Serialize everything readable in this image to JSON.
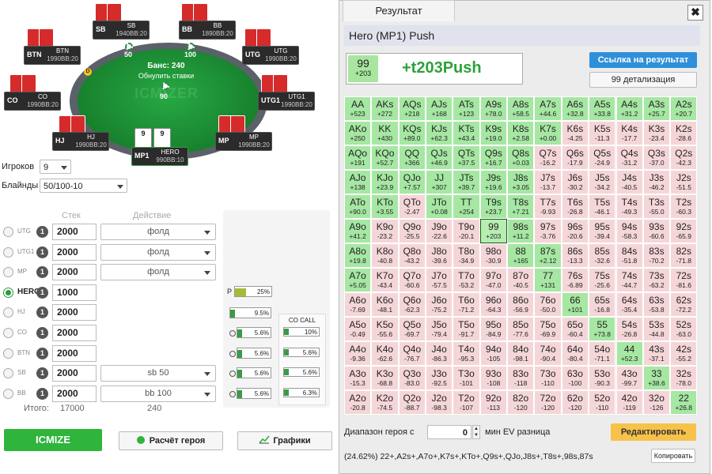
{
  "table": {
    "pot_label": "Банс: 240",
    "refresh_label": "Обнулить ставки",
    "watermark": "ICMIZER",
    "dealer_label": "D",
    "bets": {
      "sb": "50",
      "bb": "100",
      "hero": "90"
    },
    "seats": {
      "sb": {
        "pos": "SB",
        "name": "SB",
        "stack": "1940BB:20"
      },
      "bb": {
        "pos": "BB",
        "name": "BB",
        "stack": "1890BB:20"
      },
      "btn": {
        "pos": "BTN",
        "name": "BTN",
        "stack": "1990BB:20"
      },
      "utg": {
        "pos": "UTG",
        "name": "UTG",
        "stack": "1990BB:20"
      },
      "co": {
        "pos": "CO",
        "name": "CO",
        "stack": "1990BB:20"
      },
      "utg1": {
        "pos": "UTG1",
        "name": "UTG1",
        "stack": "1990BB:20"
      },
      "hj": {
        "pos": "HJ",
        "name": "HJ",
        "stack": "1990BB:20"
      },
      "mp": {
        "pos": "MP",
        "name": "MP",
        "stack": "1990BB:20"
      },
      "mp1": {
        "pos": "MP1",
        "name": "HERO",
        "stack": "990BB:10"
      }
    },
    "hero_cards": [
      "9",
      "9"
    ]
  },
  "controls": {
    "players_label": "Игроков",
    "players_value": "9",
    "blinds_label": "Блайнды",
    "blinds_value": "50/100-10",
    "stack_header": "Стек",
    "action_header": "Действие",
    "totals_label": "Итого:",
    "total_stack": "17000",
    "total_pot": "240"
  },
  "players": [
    {
      "pos": "UTG",
      "badge": "1",
      "stack": "2000",
      "action": "фолд"
    },
    {
      "pos": "UTG1",
      "badge": "1",
      "stack": "2000",
      "action": "фолд"
    },
    {
      "pos": "MP",
      "badge": "1",
      "stack": "2000",
      "action": "фолд"
    },
    {
      "pos": "HERO",
      "badge": "1",
      "stack": "1000",
      "action": ""
    },
    {
      "pos": "HJ",
      "badge": "1",
      "stack": "2000",
      "action": ""
    },
    {
      "pos": "CO",
      "badge": "1",
      "stack": "2000",
      "action": ""
    },
    {
      "pos": "BTN",
      "badge": "1",
      "stack": "2000",
      "action": ""
    },
    {
      "pos": "SB",
      "badge": "1",
      "stack": "2000",
      "action": "sb 50"
    },
    {
      "pos": "BB",
      "badge": "1",
      "stack": "2000",
      "action": "bb 100"
    }
  ],
  "mini": {
    "p_label": "P",
    "p_pct": "25%",
    "hj_pct": "9.5%",
    "o_pcts": [
      "5.6%",
      "5.6%",
      "5.6%",
      "5.6%"
    ],
    "co_call_title": "CO CALL",
    "co_call": [
      "10%",
      "5.6%",
      "5.6%",
      "6.3%"
    ]
  },
  "buttons": {
    "icmize": "ICMIZE",
    "hero_calc": "Расчёт героя",
    "charts": "Графики"
  },
  "dialog": {
    "tab": "Результат",
    "close": "✖",
    "title": "Hero (MP1) Push",
    "result_hand": "99",
    "result_value": "+203",
    "result_main": "+t203Push",
    "link_button": "Ссылка на результат",
    "detail_button": "99 детализация",
    "range_label": "Диапазон героя с",
    "range_value": "0",
    "range_suffix": "мин EV разница",
    "edit_button": "Редактировать",
    "range_text": "(24.62%) 22+,A2s+,A7o+,K7s+,KTo+,Q9s+,QJo,J8s+,T8s+,98s,87s",
    "copy_button": "Копировать"
  },
  "colors": {
    "push": "#a6e7a3",
    "fold": "#f5d6d8",
    "accent": "#2fb43c",
    "link": "#2f8fd9",
    "edit": "#f7c24a"
  },
  "matrix": [
    [
      [
        "AA",
        "+523",
        1
      ],
      [
        "AKs",
        "+272",
        1
      ],
      [
        "AQs",
        "+218",
        1
      ],
      [
        "AJs",
        "+168",
        1
      ],
      [
        "ATs",
        "+123",
        1
      ],
      [
        "A9s",
        "+78.0",
        1
      ],
      [
        "A8s",
        "+58.5",
        1
      ],
      [
        "A7s",
        "+44.6",
        1
      ],
      [
        "A6s",
        "+32.8",
        1
      ],
      [
        "A5s",
        "+33.8",
        1
      ],
      [
        "A4s",
        "+31.2",
        1
      ],
      [
        "A3s",
        "+25.7",
        1
      ],
      [
        "A2s",
        "+20.7",
        1
      ]
    ],
    [
      [
        "AKo",
        "+250",
        1
      ],
      [
        "KK",
        "+430",
        1
      ],
      [
        "KQs",
        "+89.0",
        1
      ],
      [
        "KJs",
        "+62.3",
        1
      ],
      [
        "KTs",
        "+43.4",
        1
      ],
      [
        "K9s",
        "+19.0",
        1
      ],
      [
        "K8s",
        "+2.58",
        1
      ],
      [
        "K7s",
        "+0.00",
        1
      ],
      [
        "K6s",
        "-4.25",
        0
      ],
      [
        "K5s",
        "-11.3",
        0
      ],
      [
        "K4s",
        "-17.7",
        0
      ],
      [
        "K3s",
        "-23.4",
        0
      ],
      [
        "K2s",
        "-28.6",
        0
      ]
    ],
    [
      [
        "AQo",
        "+191",
        1
      ],
      [
        "KQo",
        "+52.7",
        1
      ],
      [
        "QQ",
        "+366",
        1
      ],
      [
        "QJs",
        "+46.9",
        1
      ],
      [
        "QTs",
        "+37.5",
        1
      ],
      [
        "Q9s",
        "+16.7",
        1
      ],
      [
        "Q8s",
        "+0.03",
        1
      ],
      [
        "Q7s",
        "-16.2",
        0
      ],
      [
        "Q6s",
        "-17.9",
        0
      ],
      [
        "Q5s",
        "-24.9",
        0
      ],
      [
        "Q4s",
        "-31.2",
        0
      ],
      [
        "Q3s",
        "-37.0",
        0
      ],
      [
        "Q2s",
        "-42.3",
        0
      ]
    ],
    [
      [
        "AJo",
        "+138",
        1
      ],
      [
        "KJo",
        "+23.9",
        1
      ],
      [
        "QJo",
        "+7.57",
        1
      ],
      [
        "JJ",
        "+307",
        1
      ],
      [
        "JTs",
        "+39.7",
        1
      ],
      [
        "J9s",
        "+19.6",
        1
      ],
      [
        "J8s",
        "+3.05",
        1
      ],
      [
        "J7s",
        "-13.7",
        0
      ],
      [
        "J6s",
        "-30.2",
        0
      ],
      [
        "J5s",
        "-34.2",
        0
      ],
      [
        "J4s",
        "-40.5",
        0
      ],
      [
        "J3s",
        "-46.2",
        0
      ],
      [
        "J2s",
        "-51.5",
        0
      ]
    ],
    [
      [
        "ATo",
        "+90.0",
        1
      ],
      [
        "KTo",
        "+3.55",
        1
      ],
      [
        "QTo",
        "-2.47",
        0
      ],
      [
        "JTo",
        "+0.08",
        1
      ],
      [
        "TT",
        "+254",
        1
      ],
      [
        "T9s",
        "+23.7",
        1
      ],
      [
        "T8s",
        "+7.21",
        1
      ],
      [
        "T7s",
        "-9.93",
        0
      ],
      [
        "T6s",
        "-26.8",
        0
      ],
      [
        "T5s",
        "-46.1",
        0
      ],
      [
        "T4s",
        "-49.3",
        0
      ],
      [
        "T3s",
        "-55.0",
        0
      ],
      [
        "T2s",
        "-60.3",
        0
      ]
    ],
    [
      [
        "A9o",
        "+41.2",
        1
      ],
      [
        "K9o",
        "-23.2",
        0
      ],
      [
        "Q9o",
        "-25.5",
        0
      ],
      [
        "J9o",
        "-22.6",
        0
      ],
      [
        "T9o",
        "-20.1",
        0
      ],
      [
        "99",
        "+203",
        2
      ],
      [
        "98s",
        "+11.2",
        1
      ],
      [
        "97s",
        "-3.76",
        0
      ],
      [
        "96s",
        "-20.6",
        0
      ],
      [
        "95s",
        "-39.4",
        0
      ],
      [
        "94s",
        "-58.3",
        0
      ],
      [
        "93s",
        "-60.6",
        0
      ],
      [
        "92s",
        "-65.9",
        0
      ]
    ],
    [
      [
        "A8o",
        "+19.8",
        1
      ],
      [
        "K8o",
        "-40.8",
        0
      ],
      [
        "Q8o",
        "-43.2",
        0
      ],
      [
        "J8o",
        "-39.6",
        0
      ],
      [
        "T8o",
        "-34.9",
        0
      ],
      [
        "98o",
        "-30.9",
        0
      ],
      [
        "88",
        "+165",
        1
      ],
      [
        "87s",
        "+2.12",
        1
      ],
      [
        "86s",
        "-13.3",
        0
      ],
      [
        "85s",
        "-32.6",
        0
      ],
      [
        "84s",
        "-51.8",
        0
      ],
      [
        "83s",
        "-70.2",
        0
      ],
      [
        "82s",
        "-71.8",
        0
      ]
    ],
    [
      [
        "A7o",
        "+5.05",
        1
      ],
      [
        "K7o",
        "-43.4",
        0
      ],
      [
        "Q7o",
        "-60.6",
        0
      ],
      [
        "J7o",
        "-57.5",
        0
      ],
      [
        "T7o",
        "-53.2",
        0
      ],
      [
        "97o",
        "-47.0",
        0
      ],
      [
        "87o",
        "-40.5",
        0
      ],
      [
        "77",
        "+131",
        1
      ],
      [
        "76s",
        "-6.89",
        0
      ],
      [
        "75s",
        "-25.6",
        0
      ],
      [
        "74s",
        "-44.7",
        0
      ],
      [
        "73s",
        "-63.2",
        0
      ],
      [
        "72s",
        "-81.6",
        0
      ]
    ],
    [
      [
        "A6o",
        "-7.69",
        0
      ],
      [
        "K6o",
        "-48.1",
        0
      ],
      [
        "Q6o",
        "-62.3",
        0
      ],
      [
        "J6o",
        "-75.2",
        0
      ],
      [
        "T6o",
        "-71.2",
        0
      ],
      [
        "96o",
        "-64.3",
        0
      ],
      [
        "86o",
        "-56.9",
        0
      ],
      [
        "76o",
        "-50.0",
        0
      ],
      [
        "66",
        "+101",
        1
      ],
      [
        "65s",
        "-16.8",
        0
      ],
      [
        "64s",
        "-35.4",
        0
      ],
      [
        "63s",
        "-53.8",
        0
      ],
      [
        "62s",
        "-72.2",
        0
      ]
    ],
    [
      [
        "A5o",
        "-0.49",
        0
      ],
      [
        "K5o",
        "-55.6",
        0
      ],
      [
        "Q5o",
        "-69.7",
        0
      ],
      [
        "J5o",
        "-79.4",
        0
      ],
      [
        "T5o",
        "-91.7",
        0
      ],
      [
        "95o",
        "-84.9",
        0
      ],
      [
        "85o",
        "-77.6",
        0
      ],
      [
        "75o",
        "-69.9",
        0
      ],
      [
        "65o",
        "-60.4",
        0
      ],
      [
        "55",
        "+73.8",
        1
      ],
      [
        "54s",
        "-26.8",
        0
      ],
      [
        "53s",
        "-44.8",
        0
      ],
      [
        "52s",
        "-63.0",
        0
      ]
    ],
    [
      [
        "A4o",
        "-9.36",
        0
      ],
      [
        "K4o",
        "-62.6",
        0
      ],
      [
        "Q4o",
        "-76.7",
        0
      ],
      [
        "J4o",
        "-86.3",
        0
      ],
      [
        "T4o",
        "-95.3",
        0
      ],
      [
        "94o",
        "-105",
        0
      ],
      [
        "84o",
        "-98.1",
        0
      ],
      [
        "74o",
        "-90.4",
        0
      ],
      [
        "64o",
        "-80.4",
        0
      ],
      [
        "54o",
        "-71.1",
        0
      ],
      [
        "44",
        "+52.3",
        1
      ],
      [
        "43s",
        "-37.1",
        0
      ],
      [
        "42s",
        "-55.2",
        0
      ]
    ],
    [
      [
        "A3o",
        "-15.3",
        0
      ],
      [
        "K3o",
        "-68.8",
        0
      ],
      [
        "Q3o",
        "-83.0",
        0
      ],
      [
        "J3o",
        "-92.5",
        0
      ],
      [
        "T3o",
        "-101",
        0
      ],
      [
        "93o",
        "-108",
        0
      ],
      [
        "83o",
        "-118",
        0
      ],
      [
        "73o",
        "-110",
        0
      ],
      [
        "63o",
        "-100",
        0
      ],
      [
        "53o",
        "-90.3",
        0
      ],
      [
        "43o",
        "-99.7",
        0
      ],
      [
        "33",
        "+38.6",
        1
      ],
      [
        "32s",
        "-78.0",
        0
      ]
    ],
    [
      [
        "A2o",
        "-20.8",
        0
      ],
      [
        "K2o",
        "-74.5",
        0
      ],
      [
        "Q2o",
        "-88.7",
        0
      ],
      [
        "J2o",
        "-98.3",
        0
      ],
      [
        "T2o",
        "-107",
        0
      ],
      [
        "92o",
        "-113",
        0
      ],
      [
        "82o",
        "-120",
        0
      ],
      [
        "72o",
        "-120",
        0
      ],
      [
        "62o",
        "-120",
        0
      ],
      [
        "52o",
        "-110",
        0
      ],
      [
        "42o",
        "-119",
        0
      ],
      [
        "32o",
        "-126",
        0
      ],
      [
        "22",
        "+26.8",
        1
      ]
    ]
  ]
}
